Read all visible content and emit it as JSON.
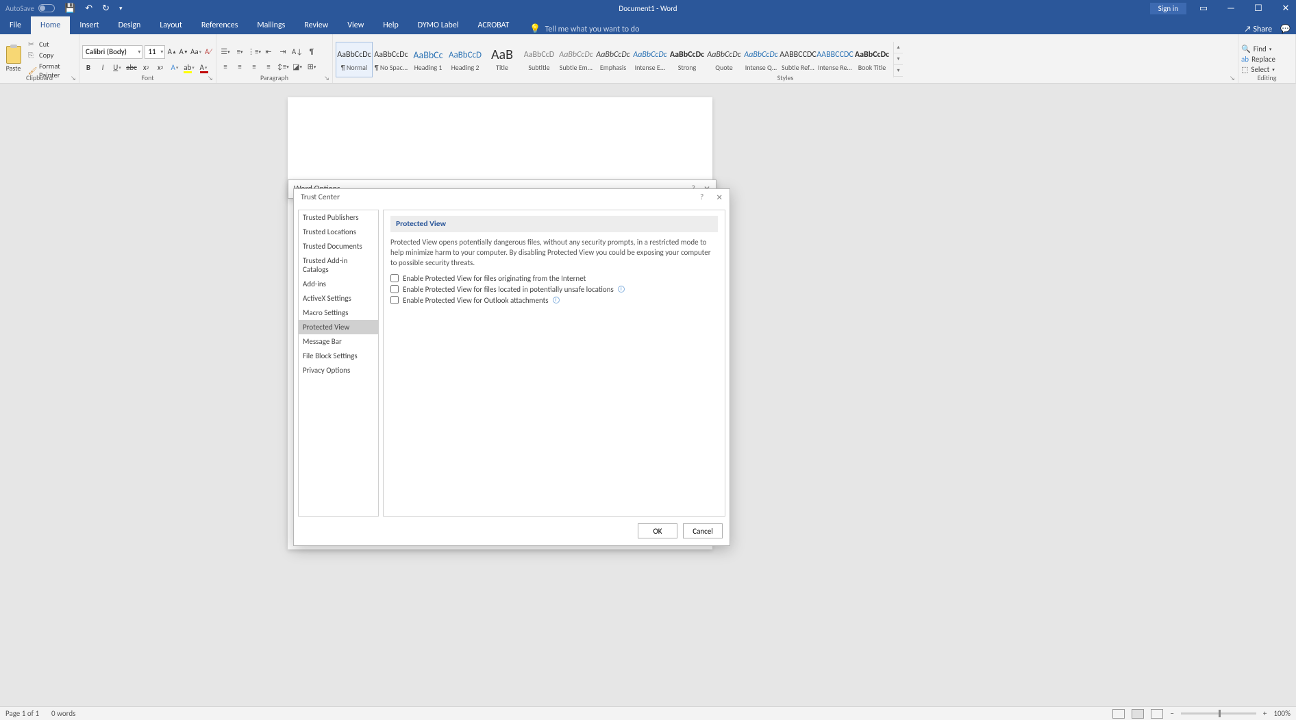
{
  "titlebar": {
    "autosave_label": "AutoSave",
    "doc_title": "Document1 - Word",
    "signin": "Sign in"
  },
  "tabs": {
    "file": "File",
    "home": "Home",
    "insert": "Insert",
    "design": "Design",
    "layout": "Layout",
    "references": "References",
    "mailings": "Mailings",
    "review": "Review",
    "view": "View",
    "help": "Help",
    "dymo": "DYMO Label",
    "acrobat": "ACROBAT",
    "tellme": "Tell me what you want to do",
    "share": "Share"
  },
  "clipboard": {
    "paste": "Paste",
    "cut": "Cut",
    "copy": "Copy",
    "fp": "Format Painter",
    "label": "Clipboard"
  },
  "font": {
    "name": "Calibri (Body)",
    "size": "11",
    "label": "Font"
  },
  "paragraph": {
    "label": "Paragraph"
  },
  "styles": {
    "label": "Styles",
    "items": [
      {
        "sample": "AaBbCcDc",
        "name": "¶ Normal",
        "cls": ""
      },
      {
        "sample": "AaBbCcDc",
        "name": "¶ No Spac...",
        "cls": ""
      },
      {
        "sample": "AaBbCc",
        "name": "Heading 1",
        "cls": "h1"
      },
      {
        "sample": "AaBbCcD",
        "name": "Heading 2",
        "cls": "h2"
      },
      {
        "sample": "AaB",
        "name": "Title",
        "cls": "title"
      },
      {
        "sample": "AaBbCcD",
        "name": "Subtitle",
        "cls": "subtitle"
      },
      {
        "sample": "AaBbCcDc",
        "name": "Subtle Em...",
        "cls": "se"
      },
      {
        "sample": "AaBbCcDc",
        "name": "Emphasis",
        "cls": "em"
      },
      {
        "sample": "AaBbCcDc",
        "name": "Intense E...",
        "cls": "ie"
      },
      {
        "sample": "AaBbCcDc",
        "name": "Strong",
        "cls": "bold"
      },
      {
        "sample": "AaBbCcDc",
        "name": "Quote",
        "cls": "quote"
      },
      {
        "sample": "AaBbCcDc",
        "name": "Intense Q...",
        "cls": "iq"
      },
      {
        "sample": "AABBCCDC",
        "name": "Subtle Ref...",
        "cls": "sr"
      },
      {
        "sample": "AABBCCDC",
        "name": "Intense Re...",
        "cls": "ir"
      },
      {
        "sample": "AaBbCcDc",
        "name": "Book Title",
        "cls": "bt"
      }
    ]
  },
  "editing": {
    "find": "Find",
    "replace": "Replace",
    "select": "Select",
    "label": "Editing"
  },
  "wopt": {
    "title": "Word Options"
  },
  "trust_center": {
    "title": "Trust Center",
    "nav": [
      "Trusted Publishers",
      "Trusted Locations",
      "Trusted Documents",
      "Trusted Add-in Catalogs",
      "Add-ins",
      "ActiveX Settings",
      "Macro Settings",
      "Protected View",
      "Message Bar",
      "File Block Settings",
      "Privacy Options"
    ],
    "heading": "Protected View",
    "desc": "Protected View opens potentially dangerous files, without any security prompts, in a restricted mode to help minimize harm to your computer. By disabling Protected View you could be exposing your computer to possible security threats.",
    "check1": "Enable Protected View for files originating from the Internet",
    "check2": "Enable Protected View for files located in potentially unsafe locations",
    "check3": "Enable Protected View for Outlook attachments",
    "ok": "OK",
    "cancel": "Cancel"
  },
  "status": {
    "page": "Page 1 of 1",
    "words": "0 words",
    "zoom": "100%"
  }
}
